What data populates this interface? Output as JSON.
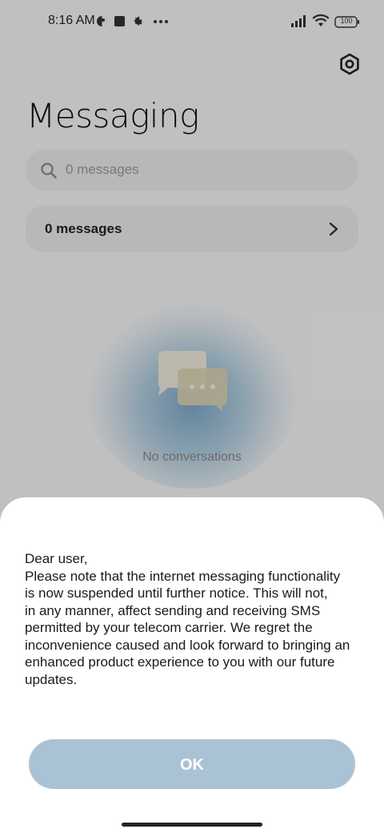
{
  "status_bar": {
    "time": "8:16 AM",
    "icons": [
      "vpn-icon",
      "square-notification-icon",
      "settings-gear-notification-icon",
      "more-dots-icon"
    ],
    "battery": "100"
  },
  "header": {
    "title": "Messaging",
    "settings_icon": "hexagon-settings-icon"
  },
  "search": {
    "placeholder": "0 messages"
  },
  "messages_row": {
    "label": "0 messages"
  },
  "empty_state": {
    "text": "No conversations"
  },
  "dialog": {
    "message": "Dear user,\nPlease note that the internet messaging functionality\nis now suspended until further notice. This will not,\nin any manner, affect sending and receiving SMS\npermitted by your telecom carrier. We regret the\ninconvenience caused and look forward to bringing an\nenhanced product experience to you with our future\nupdates.",
    "ok_label": "OK"
  },
  "colors": {
    "ok_button": "#a9c3d4",
    "glow": "#78a5c8"
  }
}
